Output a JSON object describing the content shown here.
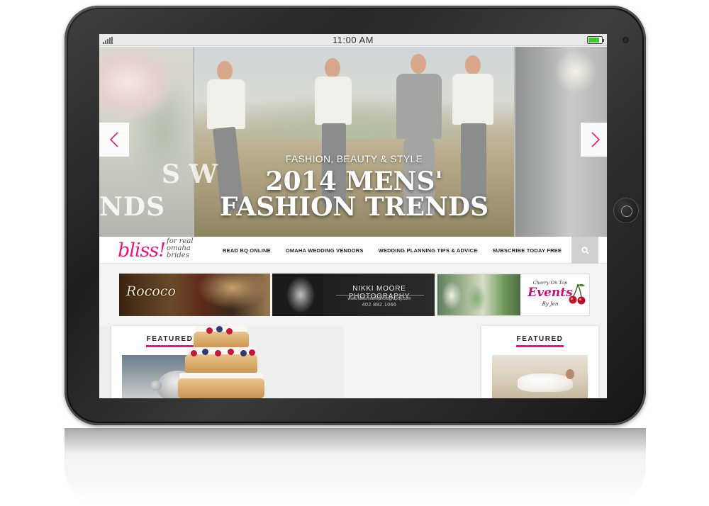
{
  "status_bar": {
    "time": "11:00 AM",
    "battery_level": 0.85,
    "colors": {
      "battery": "#3ccf2c"
    }
  },
  "hero": {
    "prev_slide_text": "NDS",
    "next_slide_text": "S W",
    "kicker": "FASHION, BEAUTY & STYLE",
    "title_line1": "2014 MENS'",
    "title_line2": "FASHION TRENDS",
    "prev_icon": "chevron-left-icon",
    "next_icon": "chevron-right-icon",
    "arrow_color": "#e6197a"
  },
  "nav": {
    "logo_word": "bliss!",
    "logo_tagline_1": "for real",
    "logo_tagline_2": "omaha",
    "logo_tagline_3": "brides",
    "items": [
      {
        "label": "READ BQ ONLINE"
      },
      {
        "label": "OMAHA WEDDING VENDORS"
      },
      {
        "label": "WEDDING PLANNING TIPS & ADVICE"
      },
      {
        "label": "SUBSCRIBE TODAY FREE"
      }
    ],
    "search_icon": "search-icon",
    "brand_color": "#e6197a"
  },
  "ads": {
    "rococo": {
      "word": "Rococo"
    },
    "nikki": {
      "name": "NIKKI MOORE PHOTOGRAPHY",
      "url": "www.nikkimoorephotography.com",
      "phone": "402.882.1066"
    },
    "cherry": {
      "line1": "Cherry On Top",
      "line2": "Events",
      "line3": "By Jen"
    }
  },
  "content": {
    "left_label": "FEATURED",
    "right_label": "FEATURED"
  }
}
